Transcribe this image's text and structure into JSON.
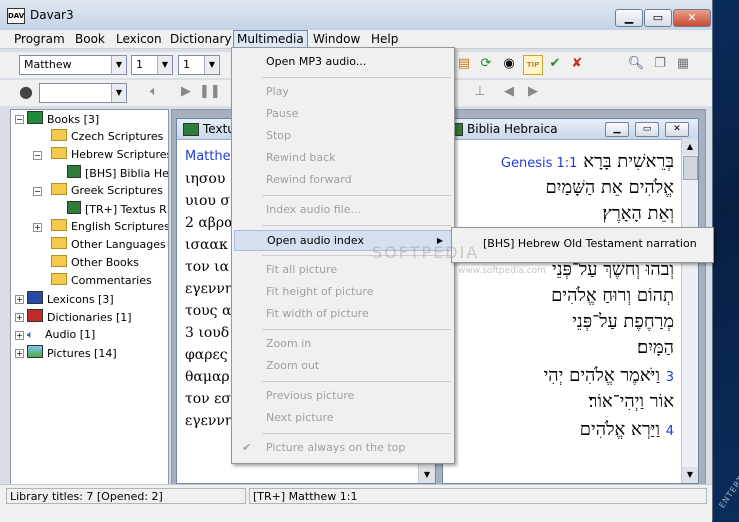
{
  "window": {
    "title": "Davar3"
  },
  "menubar": [
    "Program",
    "Book",
    "Lexicon",
    "Dictionary",
    "Multimedia",
    "Window",
    "Help"
  ],
  "toolbar": {
    "book": "Matthew",
    "chapter": "1",
    "verse": "1",
    "audio_select": ""
  },
  "tree": {
    "books": "Books [3]",
    "czech": "Czech Scriptures",
    "hebrew": "Hebrew Scriptures",
    "bhs": "[BHS] Biblia He",
    "greek": "Greek Scriptures",
    "trplus": "[TR+] Textus R",
    "english": "English Scriptures",
    "other_lang": "Other Languages",
    "other_books": "Other Books",
    "commentaries": "Commentaries",
    "lexicons": "Lexicons [3]",
    "dictionaries": "Dictionaries [1]",
    "audio": "Audio [1]",
    "pictures": "Pictures [14]"
  },
  "textus_window": {
    "title": "Textu",
    "lines": [
      "Matthew",
      "ιησου",
      "υιου σ",
      "2 αβρα",
      "ισαακ",
      "τον ια",
      "εγεννη",
      "τους α",
      "3 ιουδ",
      "φαρες",
      "θαμαρ",
      "τον εσ",
      "εγεννη"
    ]
  },
  "hebraica_window": {
    "title": "Biblia Hebraica",
    "ref": "Genesis 1:1",
    "lines": [
      "בְּרֵאשִׁית בָּרָא",
      "אֱלֹהִים אֵת הַשָּׁמַיִם",
      "וְאֵת הָאָרֶץ׃",
      "וְבֹהוּ וְחֹשֶׁךְ עַל־פְּנֵי",
      "תְהוֹם וְרוּחַ אֱלֹהִים",
      "מְרַחֶפֶת עַל־פְּנֵי",
      "הַמָּיִם׃",
      "וַיֹּאמֶר אֱלֹהִים יְהִי",
      "אוֹר וַיְהִי־אוֹר׃",
      "וַיַּרְא אֱלֹהִים"
    ],
    "verse_numbers": [
      "3",
      "4"
    ]
  },
  "multimedia_menu": [
    "Open MP3 audio...",
    "Play",
    "Pause",
    "Stop",
    "Rewind back",
    "Rewind forward",
    "Index audio file...",
    "Open audio index",
    "Fit all picture",
    "Fit height of picture",
    "Fit width of picture",
    "Zoom in",
    "Zoom out",
    "Previous picture",
    "Next picture",
    "Picture always on the top"
  ],
  "submenu": {
    "item": "[BHS] Hebrew Old Testament narration"
  },
  "status": {
    "left": "Library titles: 7  [Opened: 2]",
    "right": "[TR+]  Matthew 1:1"
  },
  "watermark": "SOFTPEDIA",
  "watermark_url": "www.softpedia.com",
  "corner_text": "ENTERTAINMENT"
}
